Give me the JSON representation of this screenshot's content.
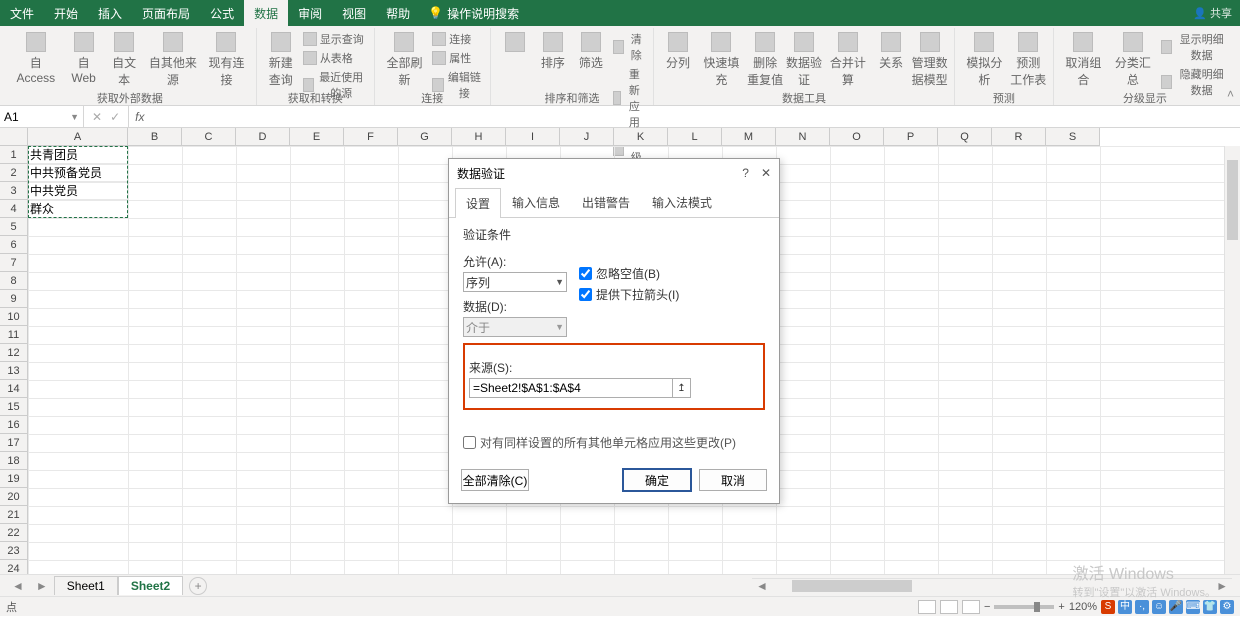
{
  "tabs": {
    "file": "文件",
    "home": "开始",
    "insert": "插入",
    "layout": "页面布局",
    "formula": "公式",
    "data": "数据",
    "review": "审阅",
    "view": "视图",
    "help": "帮助",
    "search": "操作说明搜索"
  },
  "share": "共享",
  "ribbon": {
    "ext": {
      "access": "自 Access",
      "web": "自 Web",
      "text": "自文本",
      "other": "自其他来源",
      "existing": "现有连接",
      "label": "获取外部数据"
    },
    "query": {
      "new": "新建\n查询",
      "show": "显示查询",
      "table": "从表格",
      "recent": "最近使用的源",
      "label": "获取和转换"
    },
    "conn": {
      "refresh": "全部刷新",
      "connections": "连接",
      "props": "属性",
      "edit": "编辑链接",
      "label": "连接"
    },
    "sort": {
      "sort": "排序",
      "filter": "筛选",
      "clear": "清除",
      "reapply": "重新应用",
      "adv": "高级",
      "label": "排序和筛选"
    },
    "tools": {
      "t2c": "分列",
      "flash": "快速填充",
      "dup": "删除\n重复值",
      "valid": "数据验\n证",
      "consol": "合并计算",
      "rel": "关系",
      "model": "管理数\n据模型",
      "label": "数据工具"
    },
    "forecast": {
      "what": "模拟分析",
      "sheet": "预测\n工作表",
      "label": "预测"
    },
    "outline": {
      "group": "取消组合",
      "subtotal": "分类汇总",
      "showdet": "显示明细数据",
      "hidedet": "隐藏明细数据",
      "label": "分级显示"
    }
  },
  "namebox": "A1",
  "fx": "fx",
  "columns": [
    "A",
    "B",
    "C",
    "D",
    "E",
    "F",
    "G",
    "H",
    "I",
    "J",
    "K",
    "L",
    "M",
    "N",
    "O",
    "P",
    "Q",
    "R",
    "S"
  ],
  "rowcount": 24,
  "cellsA": [
    "共青团员",
    "中共预备党员",
    "中共党员",
    "群众"
  ],
  "dialog": {
    "title": "数据验证",
    "tabs": {
      "settings": "设置",
      "input": "输入信息",
      "error": "出错警告",
      "ime": "输入法模式"
    },
    "cond": "验证条件",
    "allow": "允许(A):",
    "allow_val": "序列",
    "ignore": "忽略空值(B)",
    "dropdown": "提供下拉箭头(I)",
    "data": "数据(D):",
    "data_val": "介于",
    "source": "来源(S):",
    "source_val": "=Sheet2!$A$1:$A$4",
    "apply": "对有同样设置的所有其他单元格应用这些更改(P)",
    "clear": "全部清除(C)",
    "ok": "确定",
    "cancel": "取消"
  },
  "sheets": {
    "s1": "Sheet1",
    "s2": "Sheet2"
  },
  "status": {
    "ready": "点",
    "zoom": "120%"
  },
  "watermark": {
    "l1": "激活 Windows",
    "l2": "转到\"设置\"以激活 Windows。"
  }
}
